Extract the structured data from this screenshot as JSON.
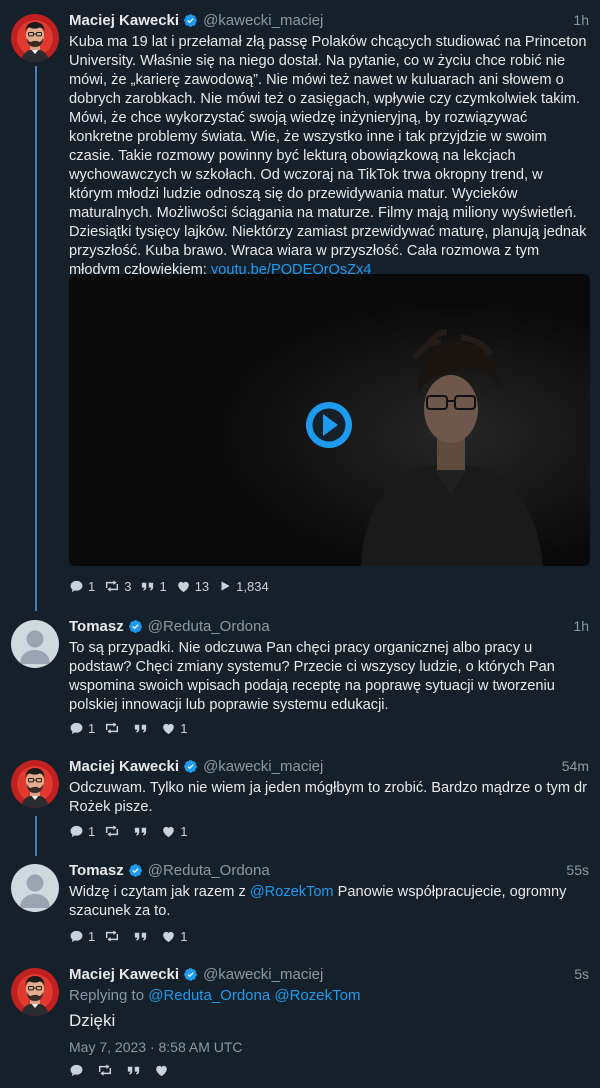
{
  "tweets": [
    {
      "name": "Maciej Kawecki",
      "handle": "@kawecki_maciej",
      "time": "1h",
      "text_before_link": "Kuba ma 19 lat i przełamał złą passę Polaków chcących studiować na Princeton University. Właśnie się na niego dostał. Na pytanie, co w życiu chce robić nie mówi, że „karierę zawodową”. Nie mówi też nawet w kuluarach ani słowem o dobrych zarobkach. Nie mówi też o zasięgach, wpływie czy czymkolwiek takim. Mówi, że chce wykorzystać swoją wiedzę inżynieryjną, by rozwiązywać konkretne problemy świata. Wie, że wszystko inne i tak przyjdzie w swoim czasie. Takie rozmowy powinny być lekturą obowiązkową na lekcjach wychowawczych w szkołach. Od wczoraj na TikTok trwa okropny trend, w którym młodzi ludzie odnoszą się do przewidywania matur. Wycieków maturalnych. Możliwości ściągania na maturze. Filmy mają miliony wyświetleń. Dziesiątki tysięcy lajków. Niektórzy zamiast przewidywać maturę, planują jednak przyszłość. Kuba brawo. Wraca wiara w przyszłość. Cała rozmowa z tym młodym człowiekiem: ",
      "link": "youtu.be/PQDEOrOsZx4",
      "replies": "1",
      "retweets": "3",
      "quotes": "1",
      "likes": "13",
      "views": "1,834"
    },
    {
      "name": "Tomasz",
      "handle": "@Reduta_Ordona",
      "time": "1h",
      "text": "To są przypadki. Nie odczuwa Pan chęci pracy organicznej albo pracy u podstaw? Chęci zmiany systemu? Przecie ci wszyscy ludzie, o których Pan wspomina swoich wpisach podają receptę na poprawę sytuacji w tworzeniu polskiej innowacji lub poprawie systemu edukacji.",
      "replies": "1",
      "likes": "1"
    },
    {
      "name": "Maciej Kawecki",
      "handle": "@kawecki_maciej",
      "time": "54m",
      "text": "Odczuwam. Tylko nie wiem ja jeden mógłbym to zrobić. Bardzo mądrze o tym dr Rożek pisze.",
      "replies": "1",
      "likes": "1"
    },
    {
      "name": "Tomasz",
      "handle": "@Reduta_Ordona",
      "time": "55s",
      "text_before_mention": "Widzę i czytam jak razem z ",
      "mention": "@RozekTom",
      "text_after_mention": " Panowie współpracujecie, ogromny szacunek za to.",
      "replies": "1",
      "likes": "1"
    },
    {
      "name": "Maciej Kawecki",
      "handle": "@kawecki_maciej",
      "time": "5s",
      "replying_label": "Replying to",
      "replying_to_1": "@Reduta_Ordona",
      "replying_to_2": "@RozekTom",
      "text": "Dzięki",
      "date": "May 7, 2023 · 8:58 AM UTC"
    }
  ],
  "colors": {
    "background": "#15202b",
    "accent": "#1d9bf0",
    "thread_line": "#4a7dbd",
    "muted": "#8b98a5"
  },
  "icons": [
    "reply-icon",
    "retweet-icon",
    "quote-icon",
    "like-icon",
    "views-icon",
    "verified-icon",
    "play-icon"
  ]
}
